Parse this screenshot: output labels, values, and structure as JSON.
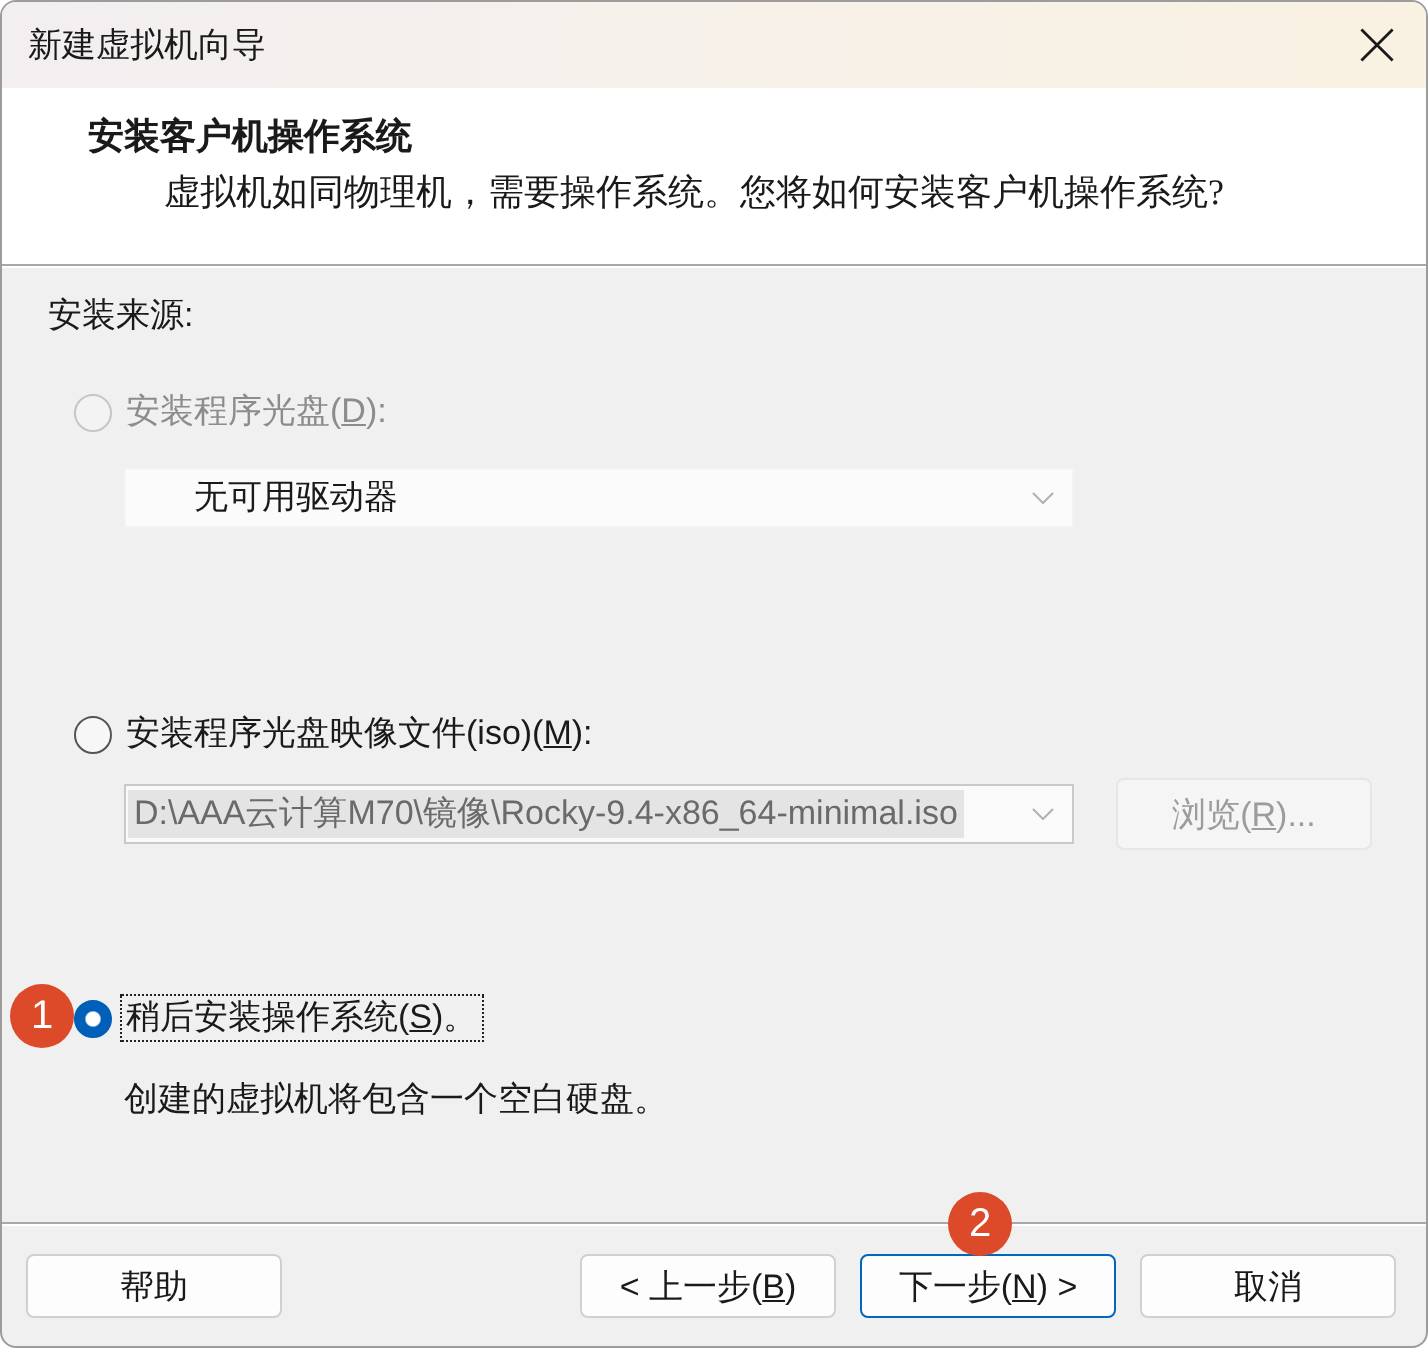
{
  "window": {
    "title": "新建虚拟机向导"
  },
  "header": {
    "title": "安装客户机操作系统",
    "subtitle": "虚拟机如同物理机，需要操作系统。您将如何安装客户机操作系统?"
  },
  "source": {
    "label": "安装来源:",
    "options": [
      {
        "label": "安装程序光盘(",
        "access_key": "D",
        "label_end": "):",
        "selected": false,
        "disabled": true,
        "focused": false,
        "combo": {
          "kind": "dropdown",
          "value": "无可用驱动器",
          "disabled": true
        }
      },
      {
        "label": "安装程序光盘映像文件(iso)(",
        "access_key": "M",
        "label_end": "):",
        "selected": false,
        "disabled": false,
        "focused": false,
        "combo": {
          "kind": "editable",
          "value": "D:\\AAA云计算M70\\镜像\\Rocky-9.4-x86_64-minimal.iso",
          "disabled": true,
          "text_selected": true
        },
        "browse": {
          "label": "浏览(",
          "access_key": "R",
          "label_end": ")...",
          "disabled": true
        }
      },
      {
        "label": "稍后安装操作系统(",
        "access_key": "S",
        "label_end": ")。",
        "selected": true,
        "disabled": false,
        "focused": true,
        "marker": "1",
        "description": "创建的虚拟机将包含一个空白硬盘。"
      }
    ]
  },
  "buttons": [
    {
      "label": "帮助",
      "default": false
    },
    {
      "label": "< 上一步(",
      "access_key": "B",
      "label_end": ")",
      "default": false
    },
    {
      "label": "下一步(",
      "access_key": "N",
      "label_end": ") >",
      "default": true,
      "marker": "2"
    },
    {
      "label": "取消",
      "default": false
    }
  ]
}
